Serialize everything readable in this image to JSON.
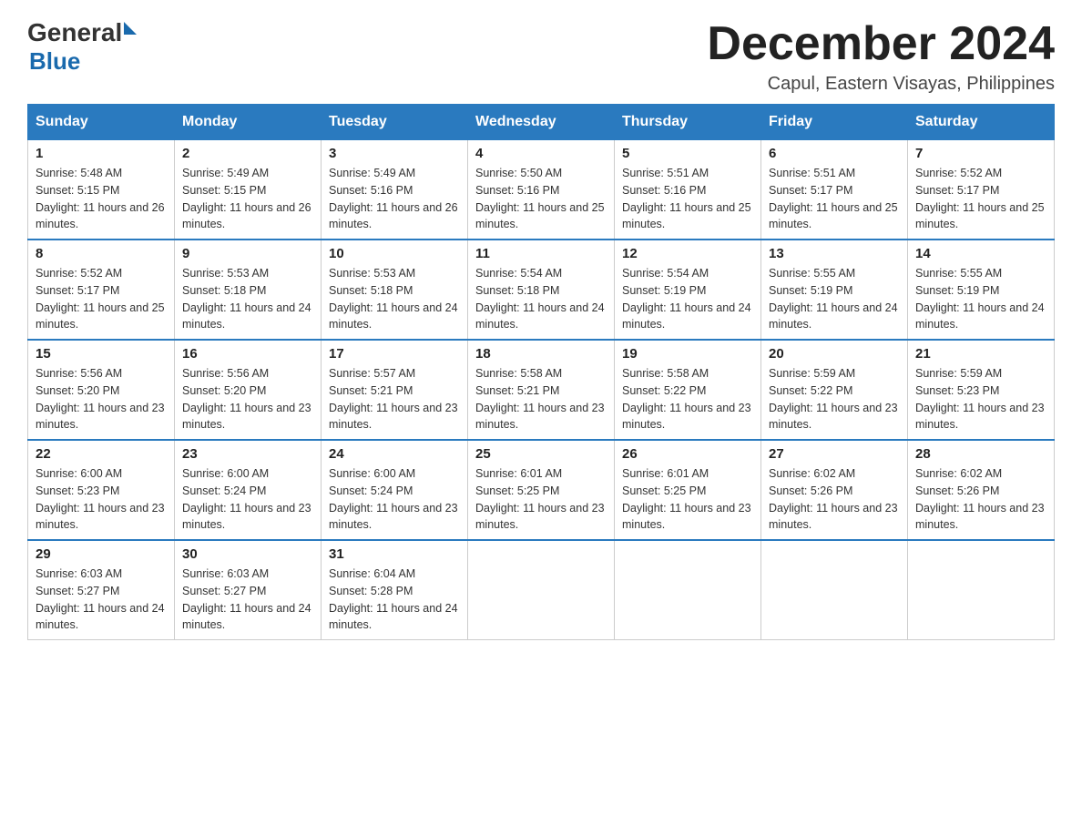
{
  "header": {
    "logo_general": "General",
    "logo_blue": "Blue",
    "month_title": "December 2024",
    "location": "Capul, Eastern Visayas, Philippines"
  },
  "weekdays": [
    "Sunday",
    "Monday",
    "Tuesday",
    "Wednesday",
    "Thursday",
    "Friday",
    "Saturday"
  ],
  "weeks": [
    [
      {
        "day": "1",
        "sunrise": "5:48 AM",
        "sunset": "5:15 PM",
        "daylight": "11 hours and 26 minutes."
      },
      {
        "day": "2",
        "sunrise": "5:49 AM",
        "sunset": "5:15 PM",
        "daylight": "11 hours and 26 minutes."
      },
      {
        "day": "3",
        "sunrise": "5:49 AM",
        "sunset": "5:16 PM",
        "daylight": "11 hours and 26 minutes."
      },
      {
        "day": "4",
        "sunrise": "5:50 AM",
        "sunset": "5:16 PM",
        "daylight": "11 hours and 25 minutes."
      },
      {
        "day": "5",
        "sunrise": "5:51 AM",
        "sunset": "5:16 PM",
        "daylight": "11 hours and 25 minutes."
      },
      {
        "day": "6",
        "sunrise": "5:51 AM",
        "sunset": "5:17 PM",
        "daylight": "11 hours and 25 minutes."
      },
      {
        "day": "7",
        "sunrise": "5:52 AM",
        "sunset": "5:17 PM",
        "daylight": "11 hours and 25 minutes."
      }
    ],
    [
      {
        "day": "8",
        "sunrise": "5:52 AM",
        "sunset": "5:17 PM",
        "daylight": "11 hours and 25 minutes."
      },
      {
        "day": "9",
        "sunrise": "5:53 AM",
        "sunset": "5:18 PM",
        "daylight": "11 hours and 24 minutes."
      },
      {
        "day": "10",
        "sunrise": "5:53 AM",
        "sunset": "5:18 PM",
        "daylight": "11 hours and 24 minutes."
      },
      {
        "day": "11",
        "sunrise": "5:54 AM",
        "sunset": "5:18 PM",
        "daylight": "11 hours and 24 minutes."
      },
      {
        "day": "12",
        "sunrise": "5:54 AM",
        "sunset": "5:19 PM",
        "daylight": "11 hours and 24 minutes."
      },
      {
        "day": "13",
        "sunrise": "5:55 AM",
        "sunset": "5:19 PM",
        "daylight": "11 hours and 24 minutes."
      },
      {
        "day": "14",
        "sunrise": "5:55 AM",
        "sunset": "5:19 PM",
        "daylight": "11 hours and 24 minutes."
      }
    ],
    [
      {
        "day": "15",
        "sunrise": "5:56 AM",
        "sunset": "5:20 PM",
        "daylight": "11 hours and 23 minutes."
      },
      {
        "day": "16",
        "sunrise": "5:56 AM",
        "sunset": "5:20 PM",
        "daylight": "11 hours and 23 minutes."
      },
      {
        "day": "17",
        "sunrise": "5:57 AM",
        "sunset": "5:21 PM",
        "daylight": "11 hours and 23 minutes."
      },
      {
        "day": "18",
        "sunrise": "5:58 AM",
        "sunset": "5:21 PM",
        "daylight": "11 hours and 23 minutes."
      },
      {
        "day": "19",
        "sunrise": "5:58 AM",
        "sunset": "5:22 PM",
        "daylight": "11 hours and 23 minutes."
      },
      {
        "day": "20",
        "sunrise": "5:59 AM",
        "sunset": "5:22 PM",
        "daylight": "11 hours and 23 minutes."
      },
      {
        "day": "21",
        "sunrise": "5:59 AM",
        "sunset": "5:23 PM",
        "daylight": "11 hours and 23 minutes."
      }
    ],
    [
      {
        "day": "22",
        "sunrise": "6:00 AM",
        "sunset": "5:23 PM",
        "daylight": "11 hours and 23 minutes."
      },
      {
        "day": "23",
        "sunrise": "6:00 AM",
        "sunset": "5:24 PM",
        "daylight": "11 hours and 23 minutes."
      },
      {
        "day": "24",
        "sunrise": "6:00 AM",
        "sunset": "5:24 PM",
        "daylight": "11 hours and 23 minutes."
      },
      {
        "day": "25",
        "sunrise": "6:01 AM",
        "sunset": "5:25 PM",
        "daylight": "11 hours and 23 minutes."
      },
      {
        "day": "26",
        "sunrise": "6:01 AM",
        "sunset": "5:25 PM",
        "daylight": "11 hours and 23 minutes."
      },
      {
        "day": "27",
        "sunrise": "6:02 AM",
        "sunset": "5:26 PM",
        "daylight": "11 hours and 23 minutes."
      },
      {
        "day": "28",
        "sunrise": "6:02 AM",
        "sunset": "5:26 PM",
        "daylight": "11 hours and 23 minutes."
      }
    ],
    [
      {
        "day": "29",
        "sunrise": "6:03 AM",
        "sunset": "5:27 PM",
        "daylight": "11 hours and 24 minutes."
      },
      {
        "day": "30",
        "sunrise": "6:03 AM",
        "sunset": "5:27 PM",
        "daylight": "11 hours and 24 minutes."
      },
      {
        "day": "31",
        "sunrise": "6:04 AM",
        "sunset": "5:28 PM",
        "daylight": "11 hours and 24 minutes."
      },
      null,
      null,
      null,
      null
    ]
  ]
}
